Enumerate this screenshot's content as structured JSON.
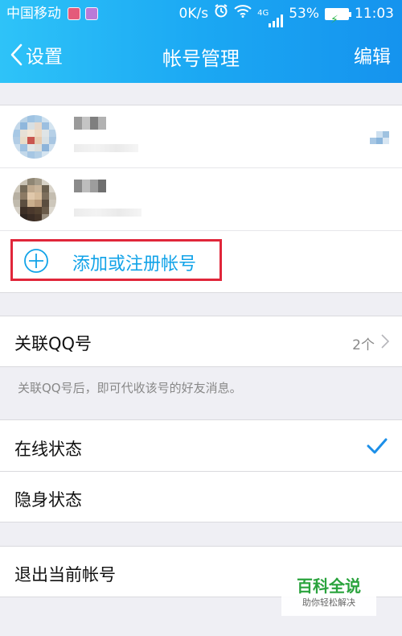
{
  "status_bar": {
    "carrier": "中国移动",
    "speed": "0K/s",
    "network_type": "4G",
    "battery_percent": "53%",
    "time": "11:03"
  },
  "nav": {
    "back_label": "设置",
    "title": "帐号管理",
    "edit_label": "编辑"
  },
  "accounts": {
    "add_label": "添加或注册帐号"
  },
  "linked_qq": {
    "label": "关联QQ号",
    "count": "2个",
    "note": "关联QQ号后，即可代收该号的好友消息。"
  },
  "status_options": {
    "online_label": "在线状态",
    "online_selected": true,
    "invisible_label": "隐身状态"
  },
  "logout_label": "退出当前帐号",
  "watermark": {
    "title": "百科全说",
    "subtitle": "助你轻松解决"
  },
  "colors": {
    "accent": "#12a3e8",
    "highlight_border": "#e0263a",
    "check": "#1c8fe8"
  }
}
